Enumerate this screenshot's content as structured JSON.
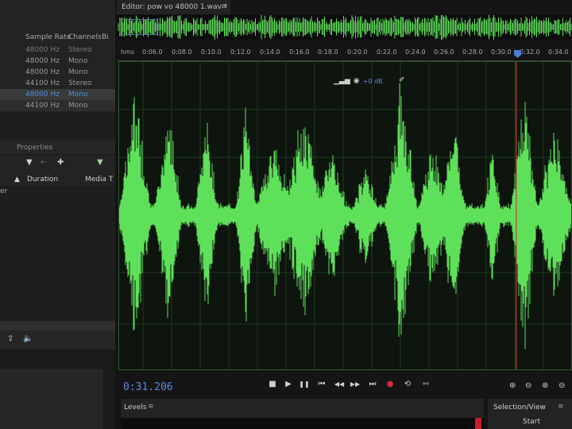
{
  "files_panel": {
    "columns": [
      "Sample Rate",
      "Channels",
      "Bi"
    ],
    "rows": [
      {
        "tag": "3",
        "sample_rate": "48000 Hz",
        "channels": "Stereo"
      },
      {
        "tag": "3",
        "sample_rate": "48000 Hz",
        "channels": "Mono"
      },
      {
        "tag": "3",
        "sample_rate": "48000 Hz",
        "channels": "Mono"
      },
      {
        "tag": "3",
        "sample_rate": "44100 Hz",
        "channels": "Stereo"
      },
      {
        "tag": "3",
        "sample_rate": "48000 Hz",
        "channels": "Mono"
      },
      {
        "tag": "r",
        "sample_rate": "44100 Hz",
        "channels": "Mono"
      }
    ],
    "selected_row": 4
  },
  "properties_panel": {
    "tab_label": "Properties",
    "columns": [
      "Duration",
      "Media T"
    ],
    "clip_label": "er"
  },
  "editor": {
    "tab_title": "Editor: pow vo 48000 1.wav *",
    "ruler_unit": "hms",
    "ruler_ticks": [
      "0:06.0",
      "0:08.0",
      "0:10.0",
      "0:12.0",
      "0:14.0",
      "0:16.0",
      "0:18.0",
      "0:20.0",
      "0:22.0",
      "0:24.0",
      "0:26.0",
      "0:28.0",
      "0:30.0",
      "0:32.0",
      "0:34.0"
    ],
    "gain_readout": "+0 dB",
    "current_time": "0:31.206",
    "playhead_time_seconds": 31.206,
    "waveform_color": "#5fe05a",
    "playhead_color": "#d2363c"
  },
  "transport": {
    "buttons": [
      {
        "name": "stop",
        "glyph": "■"
      },
      {
        "name": "play",
        "glyph": "▶"
      },
      {
        "name": "pause",
        "glyph": "❚❚"
      },
      {
        "name": "move-to-previous",
        "glyph": "⏮"
      },
      {
        "name": "rewind",
        "glyph": "◀◀"
      },
      {
        "name": "fast-forward",
        "glyph": "▶▶"
      },
      {
        "name": "move-to-next",
        "glyph": "⏭"
      },
      {
        "name": "record",
        "glyph": "●"
      },
      {
        "name": "loop-playback",
        "glyph": "⟲"
      },
      {
        "name": "skip-selection",
        "glyph": "⇿"
      }
    ]
  },
  "levels_panel": {
    "title": "Levels",
    "menu": "≡"
  },
  "selection_view_panel": {
    "title": "Selection/View",
    "menu": "≡",
    "start_label": "Start"
  },
  "common": {
    "panel_menu": "≡"
  }
}
